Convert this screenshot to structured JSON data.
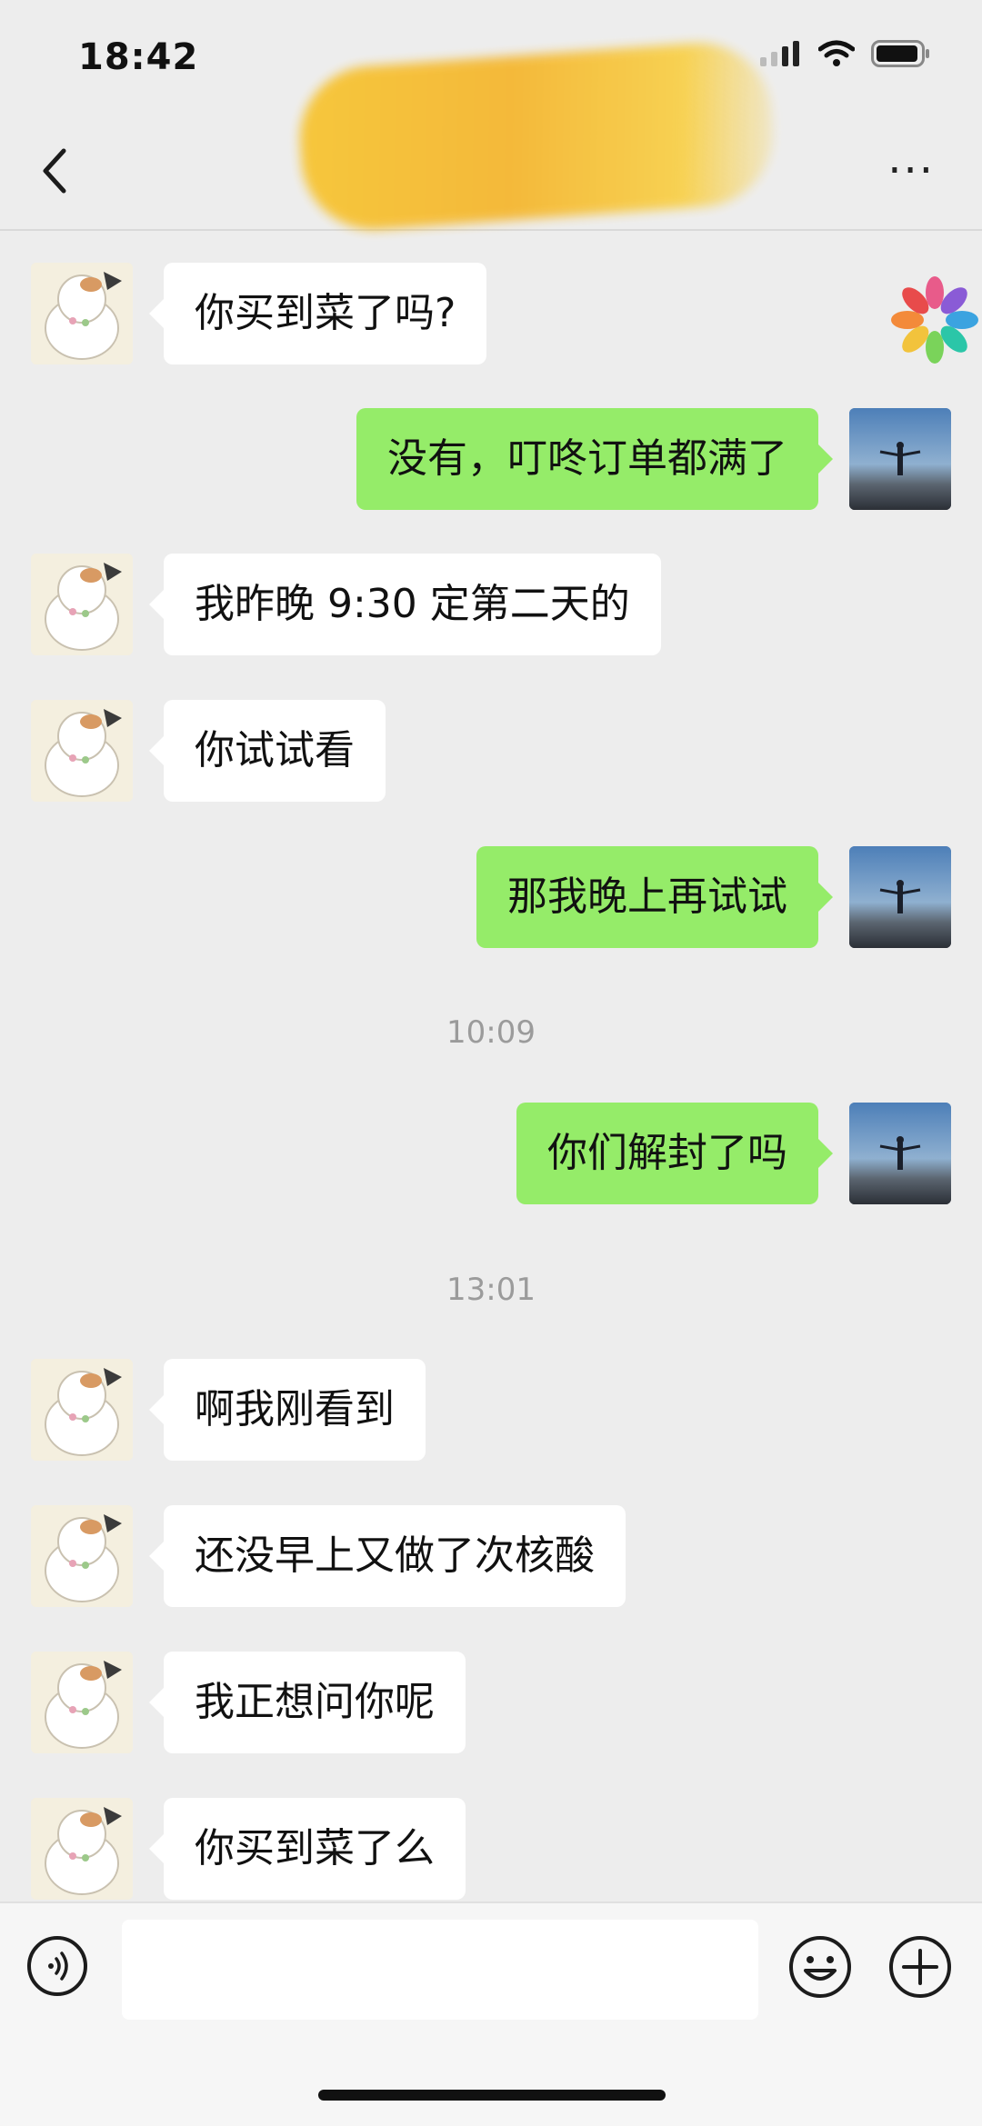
{
  "status_bar": {
    "time": "18:42"
  },
  "nav": {
    "back_icon": "chevron-left-icon",
    "more_icon": "more-dots-icon",
    "more_label": "···"
  },
  "chat": {
    "messages": [
      {
        "side": "left",
        "text": "你买到菜了吗?"
      },
      {
        "side": "right",
        "text": "没有，叮咚订单都满了"
      },
      {
        "side": "left",
        "text": "我昨晚 9:30 定第二天的"
      },
      {
        "side": "left",
        "text": "你试试看"
      },
      {
        "side": "right",
        "text": "那我晚上再试试"
      },
      {
        "side": "right",
        "text": "你们解封了吗"
      },
      {
        "side": "left",
        "text": "啊我刚看到"
      },
      {
        "side": "left",
        "text": "还没早上又做了次核酸"
      },
      {
        "side": "left",
        "text": "我正想问你呢"
      },
      {
        "side": "left",
        "text": "你买到菜了么"
      }
    ],
    "timestamps": [
      "10:09",
      "13:01"
    ]
  },
  "input_bar": {
    "voice_icon": "voice-icon",
    "emoji_icon": "emoji-icon",
    "plus_icon": "plus-icon",
    "input_value": ""
  },
  "colors": {
    "background": "#ededed",
    "sent_bubble": "#95ec69",
    "received_bubble": "#ffffff",
    "timestamp": "#9b9b9b"
  }
}
